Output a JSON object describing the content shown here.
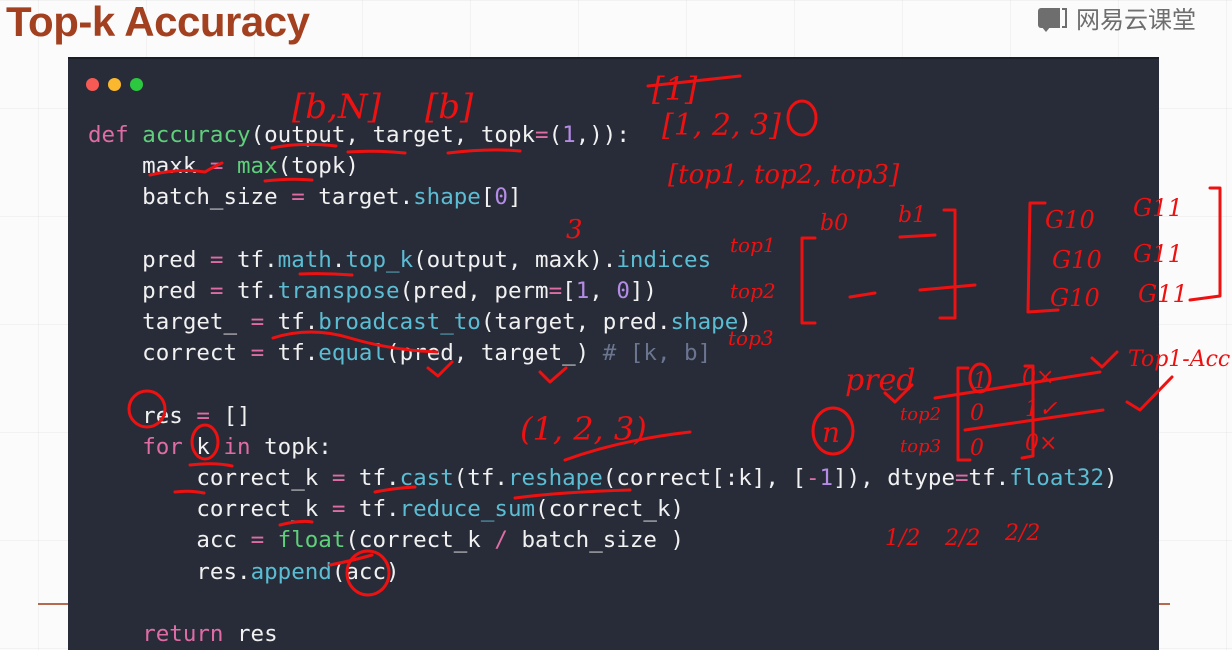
{
  "slide": {
    "title": "Top-k Accuracy",
    "brand": "网易云课堂",
    "brand_icon": "chat-book-icon"
  },
  "window": {
    "controls": [
      "close",
      "minimize",
      "maximize"
    ]
  },
  "code": {
    "language": "python",
    "lines": [
      [
        {
          "t": "def",
          "c": "kw"
        },
        {
          "t": " "
        },
        {
          "t": "accuracy",
          "c": "fn"
        },
        {
          "t": "(output, target, topk"
        },
        {
          "t": "=",
          "c": "op"
        },
        {
          "t": "("
        },
        {
          "t": "1",
          "c": "num"
        },
        {
          "t": ",)):"
        }
      ],
      [
        {
          "t": "    maxk "
        },
        {
          "t": "=",
          "c": "op"
        },
        {
          "t": " "
        },
        {
          "t": "max",
          "c": "fn"
        },
        {
          "t": "(topk)"
        }
      ],
      [
        {
          "t": "    batch_size "
        },
        {
          "t": "=",
          "c": "op"
        },
        {
          "t": " target."
        },
        {
          "t": "shape",
          "c": "at"
        },
        {
          "t": "["
        },
        {
          "t": "0",
          "c": "num"
        },
        {
          "t": "]"
        }
      ],
      [],
      [
        {
          "t": "    pred "
        },
        {
          "t": "=",
          "c": "op"
        },
        {
          "t": " tf."
        },
        {
          "t": "math",
          "c": "at"
        },
        {
          "t": "."
        },
        {
          "t": "top_k",
          "c": "at"
        },
        {
          "t": "(output, maxk)."
        },
        {
          "t": "indices",
          "c": "at"
        }
      ],
      [
        {
          "t": "    pred "
        },
        {
          "t": "=",
          "c": "op"
        },
        {
          "t": " tf."
        },
        {
          "t": "transpose",
          "c": "at"
        },
        {
          "t": "(pred, perm"
        },
        {
          "t": "=",
          "c": "op"
        },
        {
          "t": "["
        },
        {
          "t": "1",
          "c": "num"
        },
        {
          "t": ", "
        },
        {
          "t": "0",
          "c": "num"
        },
        {
          "t": "])"
        }
      ],
      [
        {
          "t": "    target_ "
        },
        {
          "t": "=",
          "c": "op"
        },
        {
          "t": " tf."
        },
        {
          "t": "broadcast_to",
          "c": "at"
        },
        {
          "t": "(target, pred."
        },
        {
          "t": "shape",
          "c": "at"
        },
        {
          "t": ")"
        }
      ],
      [
        {
          "t": "    correct "
        },
        {
          "t": "=",
          "c": "op"
        },
        {
          "t": " tf."
        },
        {
          "t": "equal",
          "c": "at"
        },
        {
          "t": "(pred, target_) "
        },
        {
          "t": "# [k, b]",
          "c": "cm"
        }
      ],
      [],
      [
        {
          "t": "    res "
        },
        {
          "t": "=",
          "c": "op"
        },
        {
          "t": " []"
        }
      ],
      [
        {
          "t": "    "
        },
        {
          "t": "for",
          "c": "kw"
        },
        {
          "t": " k "
        },
        {
          "t": "in",
          "c": "kw"
        },
        {
          "t": " topk:"
        }
      ],
      [
        {
          "t": "        correct_k "
        },
        {
          "t": "=",
          "c": "op"
        },
        {
          "t": " tf."
        },
        {
          "t": "cast",
          "c": "at"
        },
        {
          "t": "(tf."
        },
        {
          "t": "reshape",
          "c": "at"
        },
        {
          "t": "(correct[:k], ["
        },
        {
          "t": "-",
          "c": "op"
        },
        {
          "t": "1",
          "c": "num"
        },
        {
          "t": "]), dtype"
        },
        {
          "t": "=",
          "c": "op"
        },
        {
          "t": "tf."
        },
        {
          "t": "float32",
          "c": "at"
        },
        {
          "t": ")"
        }
      ],
      [
        {
          "t": "        correct_k "
        },
        {
          "t": "=",
          "c": "op"
        },
        {
          "t": " tf."
        },
        {
          "t": "reduce_sum",
          "c": "at"
        },
        {
          "t": "(correct_k)"
        }
      ],
      [
        {
          "t": "        acc "
        },
        {
          "t": "=",
          "c": "op"
        },
        {
          "t": " "
        },
        {
          "t": "float",
          "c": "fn"
        },
        {
          "t": "(correct_k "
        },
        {
          "t": "/",
          "c": "op"
        },
        {
          "t": " batch_size )"
        }
      ],
      [
        {
          "t": "        res."
        },
        {
          "t": "append",
          "c": "at"
        },
        {
          "t": "(acc)"
        }
      ],
      [],
      [
        {
          "t": "    "
        },
        {
          "t": "return",
          "c": "kw"
        },
        {
          "t": " res"
        }
      ]
    ]
  },
  "annotations": {
    "output_shape": "[b,N]",
    "target_shape": "[b]",
    "topk_single": "[1]",
    "topk_list": "[1, 2, 3]",
    "topk_names": "[top1, top2, top3]",
    "maxk_note": "3",
    "row_labels": [
      "top1",
      "top2",
      "top3"
    ],
    "col_labels": [
      "b0",
      "b1"
    ],
    "target_matrix": [
      "G10",
      "G11"
    ],
    "pred_label": "pred",
    "n_label": "n",
    "correct_matrix": [
      [
        "1",
        "0×"
      ],
      [
        "0",
        "1✓"
      ],
      [
        "0",
        "0×"
      ]
    ],
    "top1_acc_label": "Top1-Acc",
    "topk_tuple": "(1, 2, 3)",
    "fractions": [
      "1/2",
      "2/2",
      "2/2"
    ]
  }
}
